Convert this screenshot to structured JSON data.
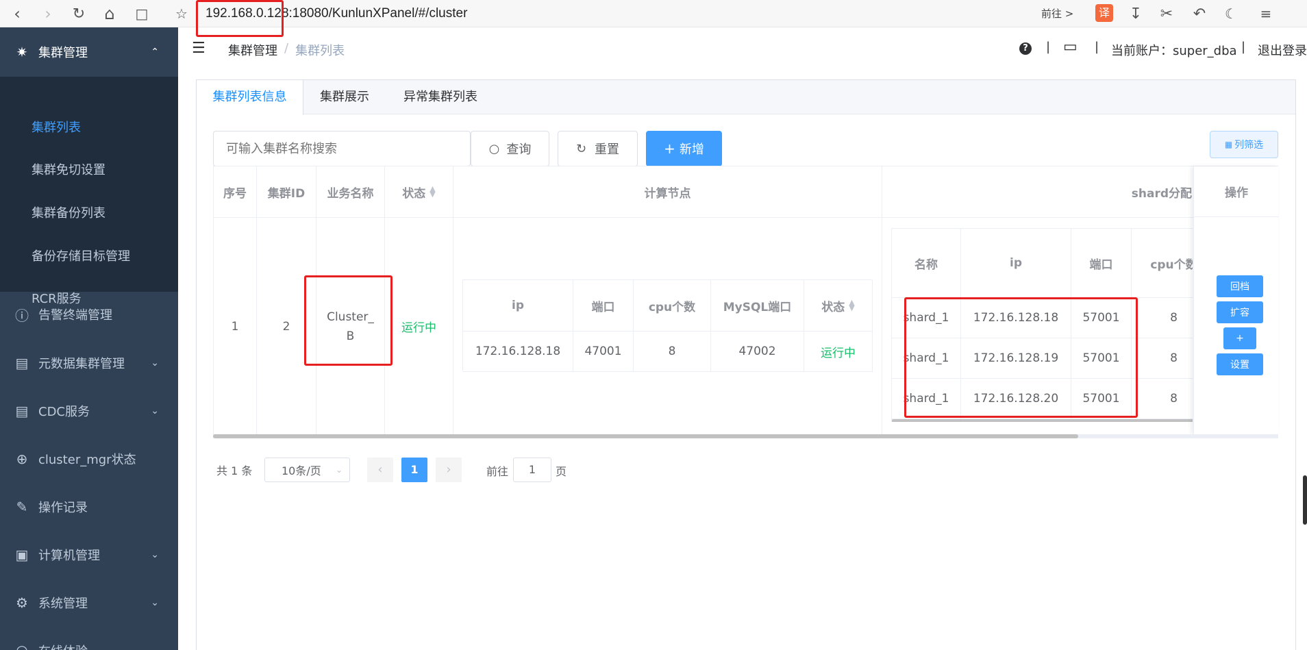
{
  "browser": {
    "url": "192.168.0.128:18080/KunlunXPanel/#/cluster",
    "go_label": "前往 >",
    "translate_label": "译"
  },
  "sidebar": {
    "group_title": "集群管理",
    "sub_items": [
      "集群列表",
      "集群免切设置",
      "集群备份列表",
      "备份存储目标管理",
      "RCR服务"
    ],
    "items": [
      "告警终端管理",
      "元数据集群管理",
      "CDC服务",
      "cluster_mgr状态",
      "操作记录",
      "计算机管理",
      "系统管理",
      "在线体验"
    ]
  },
  "header": {
    "breadcrumb_root": "集群管理",
    "breadcrumb_sep": "/",
    "breadcrumb_current": "集群列表",
    "help": "?",
    "sep": "|",
    "account_label": "当前账户：super_dba",
    "logout_label": "退出登录"
  },
  "tabs": [
    "集群列表信息",
    "集群展示",
    "异常集群列表"
  ],
  "toolbar": {
    "search_placeholder": "可输入集群名称搜索",
    "query_label": "查询",
    "reset_label": "重置",
    "add_label": "新增",
    "column_filter_label": "列筛选"
  },
  "main_table": {
    "headers": {
      "seq": "序号",
      "cluster_id": "集群ID",
      "biz_name": "业务名称",
      "status": "状态",
      "compute": "计算节点",
      "shard": "shard分配",
      "ops": "操作"
    },
    "row": {
      "seq": "1",
      "cluster_id": "2",
      "biz_name_1": "Cluster_",
      "biz_name_2": "B",
      "status": "运行中"
    }
  },
  "compute_table": {
    "headers": [
      "ip",
      "端口",
      "cpu个数",
      "MySQL端口",
      "状态"
    ],
    "rows": [
      [
        "172.16.128.18",
        "47001",
        "8",
        "47002",
        "运行中"
      ]
    ]
  },
  "shard_table": {
    "headers": [
      "名称",
      "ip",
      "端口",
      "cpu个数"
    ],
    "rows": [
      [
        "shard_1",
        "172.16.128.18",
        "57001",
        "8"
      ],
      [
        "shard_1",
        "172.16.128.19",
        "57001",
        "8"
      ],
      [
        "shard_1",
        "172.16.128.20",
        "57001",
        "8"
      ]
    ]
  },
  "ops": [
    "回档",
    "扩容",
    "+",
    "设置"
  ],
  "pagination": {
    "total": "共 1 条",
    "page_size": "10条/页",
    "current_page": "1",
    "goto_label": "前往",
    "goto_value": "1",
    "page_unit": "页"
  },
  "colors": {
    "sidebar_bg": "#304156",
    "submenu_bg": "#1f2d3d",
    "primary": "#409eff",
    "running": "#19be6b",
    "highlight": "#e62020"
  }
}
